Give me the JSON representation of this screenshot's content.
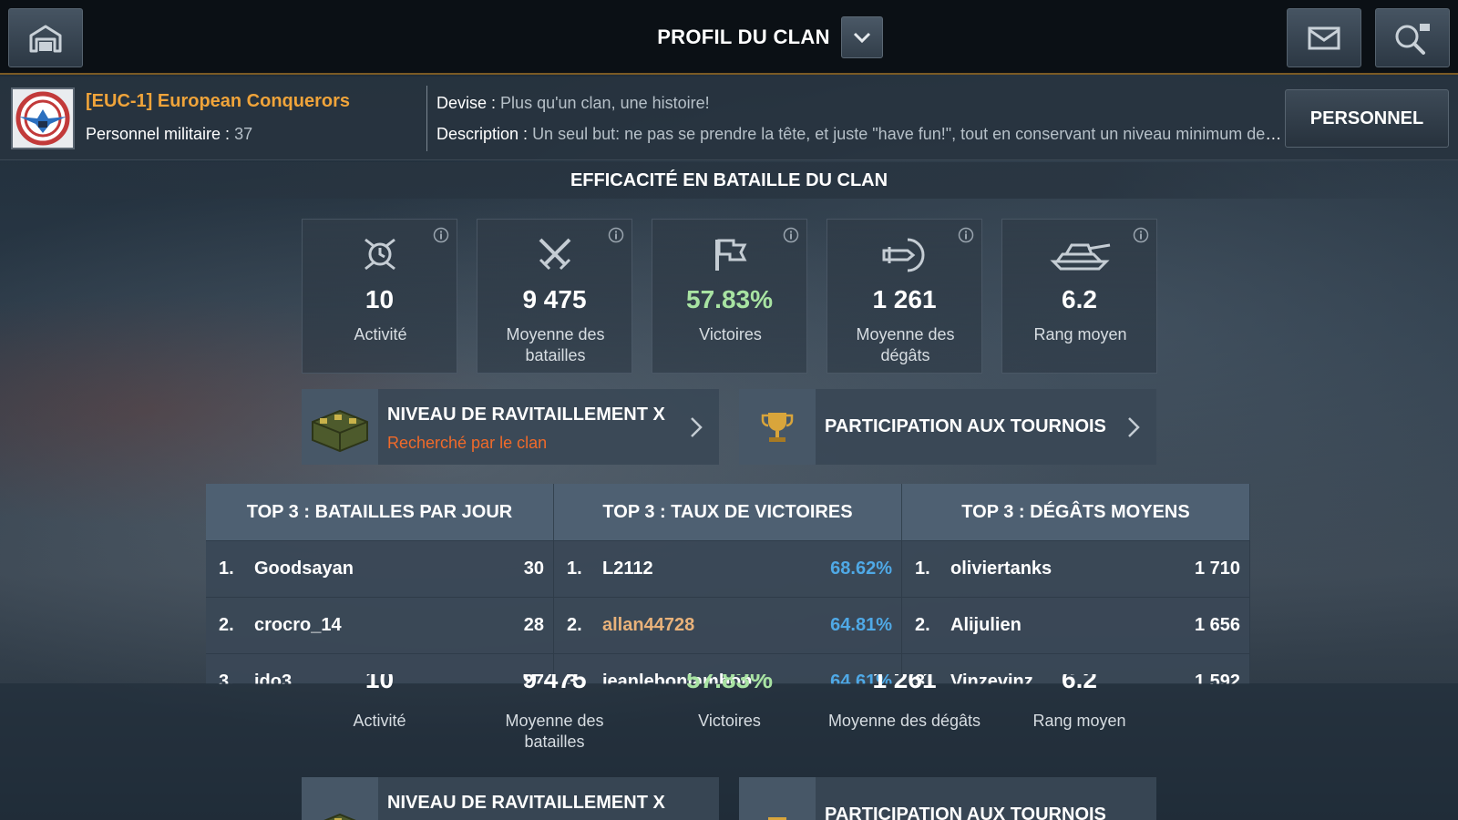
{
  "topbar": {
    "title": "PROFIL DU CLAN",
    "home_icon": "garage-icon",
    "mail_icon": "mail-icon",
    "search_icon": "clan-search-icon"
  },
  "clan": {
    "name": "[EUC-1] European Conquerors",
    "members_label": "Personnel militaire :",
    "members_value": "37",
    "motto_label": "Devise :",
    "motto_value": "Plus qu'un clan, une histoire!",
    "description_label": "Description :",
    "description_value": "Un seul but: ne pas se prendre la tête, et juste \"have fun!\", tout en conservant un niveau minimum de statsSi vou...",
    "personnel_button": "PERSONNEL"
  },
  "efficiency": {
    "title": "EFFICACITÉ EN BATAILLE DU CLAN",
    "stats": [
      {
        "icon": "activity-icon",
        "value": "10",
        "label": "Activité"
      },
      {
        "icon": "crossed-swords-icon",
        "value": "9 475",
        "label": "Moyenne des batailles"
      },
      {
        "icon": "flag-icon",
        "value": "57.83%",
        "label": "Victoires"
      },
      {
        "icon": "damage-icon",
        "value": "1 261",
        "label": "Moyenne des dégâts"
      },
      {
        "icon": "tank-icon",
        "value": "6.2",
        "label": "Rang moyen"
      }
    ]
  },
  "supply": {
    "title": "NIVEAU DE RAVITAILLEMENT X",
    "subtitle": "Recherché par le clan"
  },
  "tournaments": {
    "title": "PARTICIPATION AUX TOURNOIS"
  },
  "top3": [
    {
      "header": "TOP 3 : BATAILLES PAR JOUR",
      "rows": [
        {
          "rank": "1.",
          "name": "Goodsayan",
          "value": "30"
        },
        {
          "rank": "2.",
          "name": "crocro_14",
          "value": "28"
        },
        {
          "rank": "3.",
          "name": "ido3",
          "value": "27"
        }
      ]
    },
    {
      "header": "TOP 3 : TAUX DE VICTOIRES",
      "rows": [
        {
          "rank": "1.",
          "name": "L2112",
          "value": "68.62%"
        },
        {
          "rank": "2.",
          "name": "allan44728",
          "value": "64.81%"
        },
        {
          "rank": "3.",
          "name": "jeanlebonjambon",
          "value": "64.61%"
        }
      ]
    },
    {
      "header": "TOP 3 : DÉGÂTS MOYENS",
      "rows": [
        {
          "rank": "1.",
          "name": "oliviertanks",
          "value": "1 710"
        },
        {
          "rank": "2.",
          "name": "Alijulien",
          "value": "1 656"
        },
        {
          "rank": "3.",
          "name": "Vinzevinz",
          "value": "1 592"
        }
      ]
    }
  ]
}
